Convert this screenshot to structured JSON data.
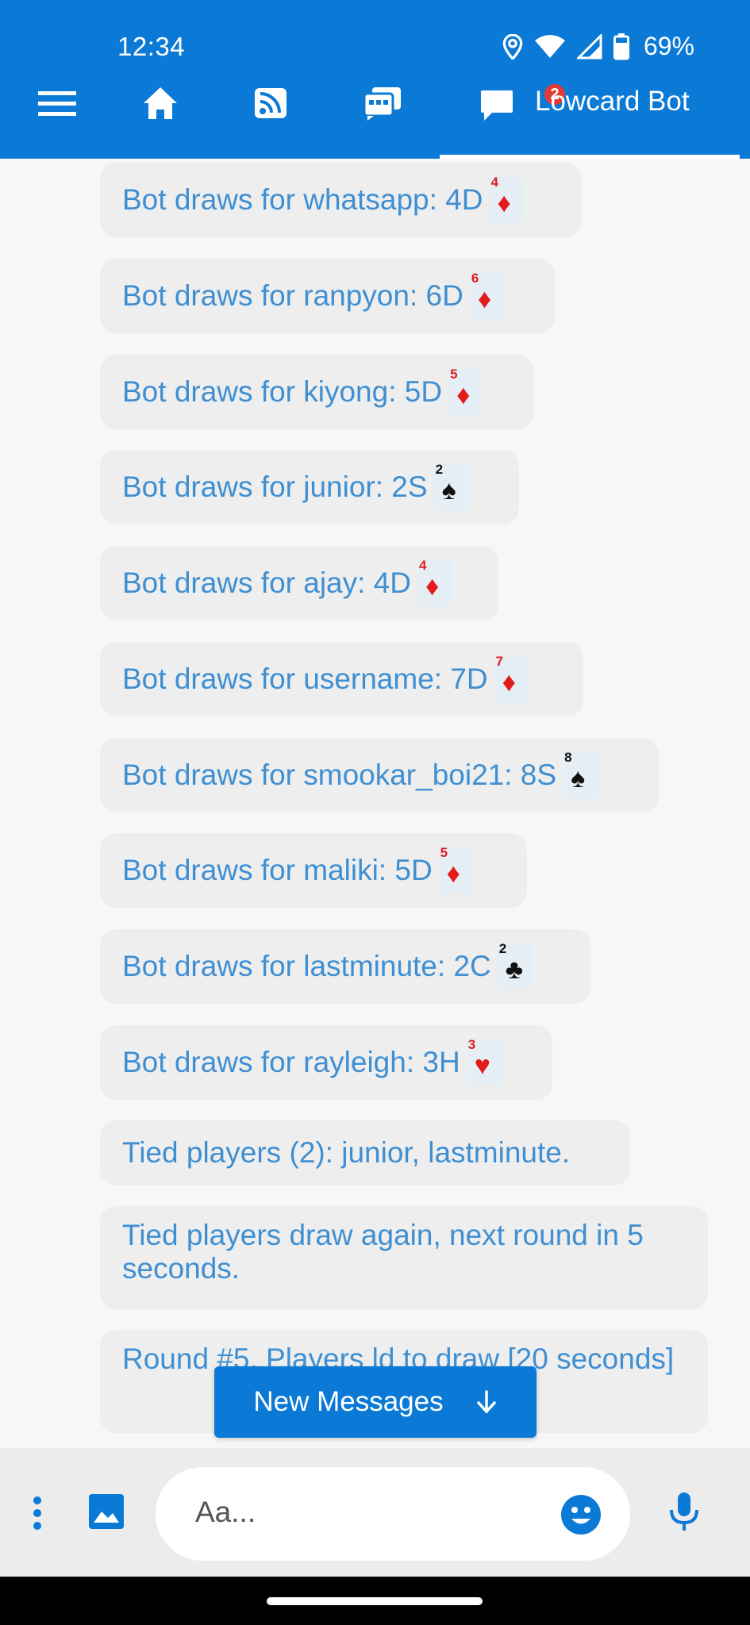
{
  "status_bar": {
    "time": "12:34",
    "battery": "69%"
  },
  "nav": {
    "items": [
      {
        "name": "menu-icon"
      },
      {
        "name": "home-icon"
      },
      {
        "name": "feed-icon"
      },
      {
        "name": "chatrooms-icon"
      }
    ],
    "active": {
      "label": "Lowcard Bot",
      "badge": "2",
      "icon": "chat-icon"
    }
  },
  "messages": [
    {
      "text": "Bot draws for whatsapp: 4D",
      "card": {
        "rank": "4",
        "suit": "♦",
        "color": "red"
      }
    },
    {
      "text": "Bot draws for ranpyon: 6D",
      "card": {
        "rank": "6",
        "suit": "♦",
        "color": "red"
      }
    },
    {
      "text": "Bot draws for kiyong: 5D",
      "card": {
        "rank": "5",
        "suit": "♦",
        "color": "red"
      }
    },
    {
      "text": "Bot draws for junior: 2S",
      "card": {
        "rank": "2",
        "suit": "♠",
        "color": "black"
      }
    },
    {
      "text": "Bot draws for ajay: 4D",
      "card": {
        "rank": "4",
        "suit": "♦",
        "color": "red"
      }
    },
    {
      "text": "Bot draws for username: 7D",
      "card": {
        "rank": "7",
        "suit": "♦",
        "color": "red"
      }
    },
    {
      "text": "Bot draws for smookar_boi21: 8S",
      "card": {
        "rank": "8",
        "suit": "♠",
        "color": "black"
      }
    },
    {
      "text": "Bot draws for maliki: 5D",
      "card": {
        "rank": "5",
        "suit": "♦",
        "color": "red"
      }
    },
    {
      "text": "Bot draws for lastminute: 2C",
      "card": {
        "rank": "2",
        "suit": "♣",
        "color": "black"
      }
    },
    {
      "text": "Bot draws for rayleigh: 3H",
      "card": {
        "rank": "3",
        "suit": "♥",
        "color": "red"
      }
    },
    {
      "text": "Tied players (2): junior, lastminute."
    },
    {
      "text": "Tied players draw again, next round in 5 seconds."
    },
    {
      "text": "Round #5. Players ld to draw [20 seconds]"
    }
  ],
  "new_messages_button": {
    "label": "New Messages"
  },
  "input": {
    "placeholder": "Aa..."
  },
  "colors": {
    "primary": "#0a7ad6",
    "bubble_text": "#3f8fd2",
    "bubble_bg": "#eeeeee",
    "badge": "#e53935"
  }
}
